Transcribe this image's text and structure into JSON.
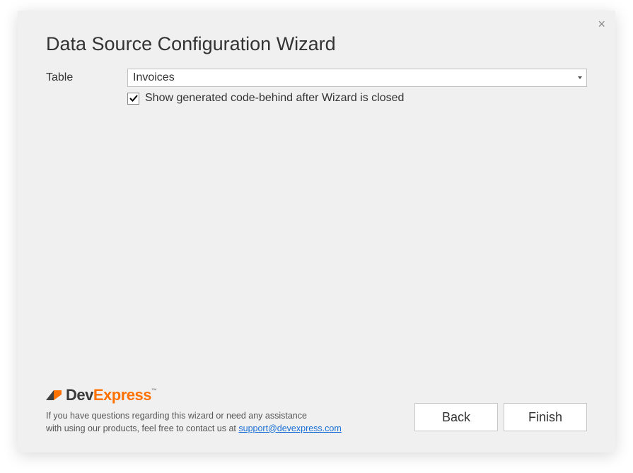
{
  "title": "Data Source Configuration Wizard",
  "form": {
    "tableLabel": "Table",
    "tableValue": "Invoices",
    "showCodeChecked": true,
    "showCodeLabel": "Show generated code-behind after Wizard is closed"
  },
  "footer": {
    "logoPart1": "Dev",
    "logoPart2": "Express",
    "support1": "If you have questions regarding this wizard or need any assistance",
    "support2": "with using our products, feel free to contact us at ",
    "supportEmail": "support@devexpress.com"
  },
  "buttons": {
    "back": "Back",
    "finish": "Finish"
  }
}
